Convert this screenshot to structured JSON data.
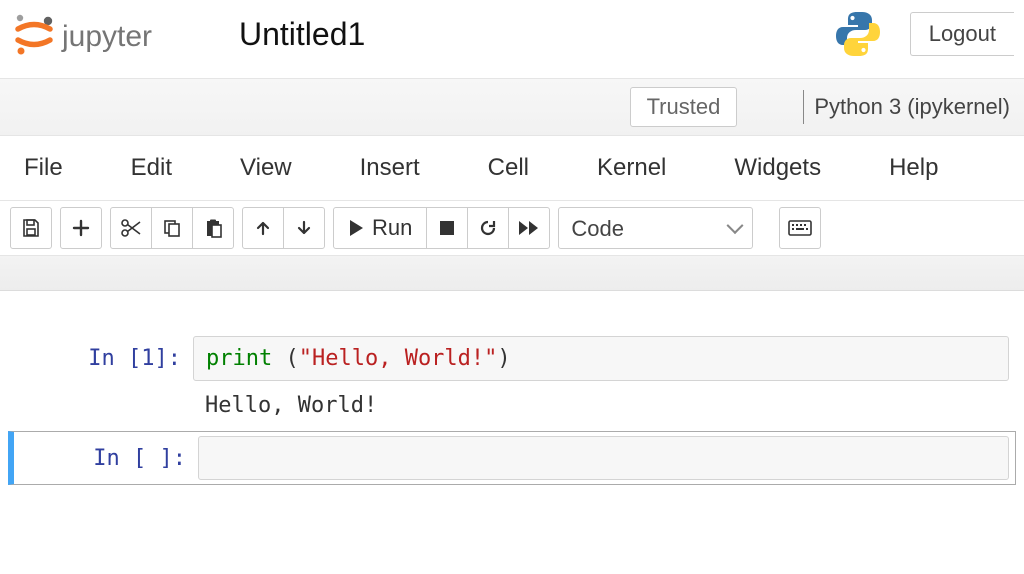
{
  "header": {
    "brand_text": "jupyter",
    "notebook_name": "Untitled1",
    "logout_label": "Logout"
  },
  "kernel_bar": {
    "trusted_label": "Trusted",
    "kernel_name": "Python 3 (ipykernel)"
  },
  "menu": {
    "items": [
      "File",
      "Edit",
      "View",
      "Insert",
      "Cell",
      "Kernel",
      "Widgets",
      "Help"
    ]
  },
  "toolbar": {
    "run_label": "Run",
    "cell_type": "Code"
  },
  "cells": [
    {
      "prompt_label": "In [1]:",
      "code_tokens": {
        "builtin": "print",
        "space": " ",
        "open": "(",
        "string": "\"Hello, World!\"",
        "close": ")"
      },
      "output": "Hello, World!"
    },
    {
      "prompt_label": "In [ ]:",
      "code": ""
    }
  ]
}
